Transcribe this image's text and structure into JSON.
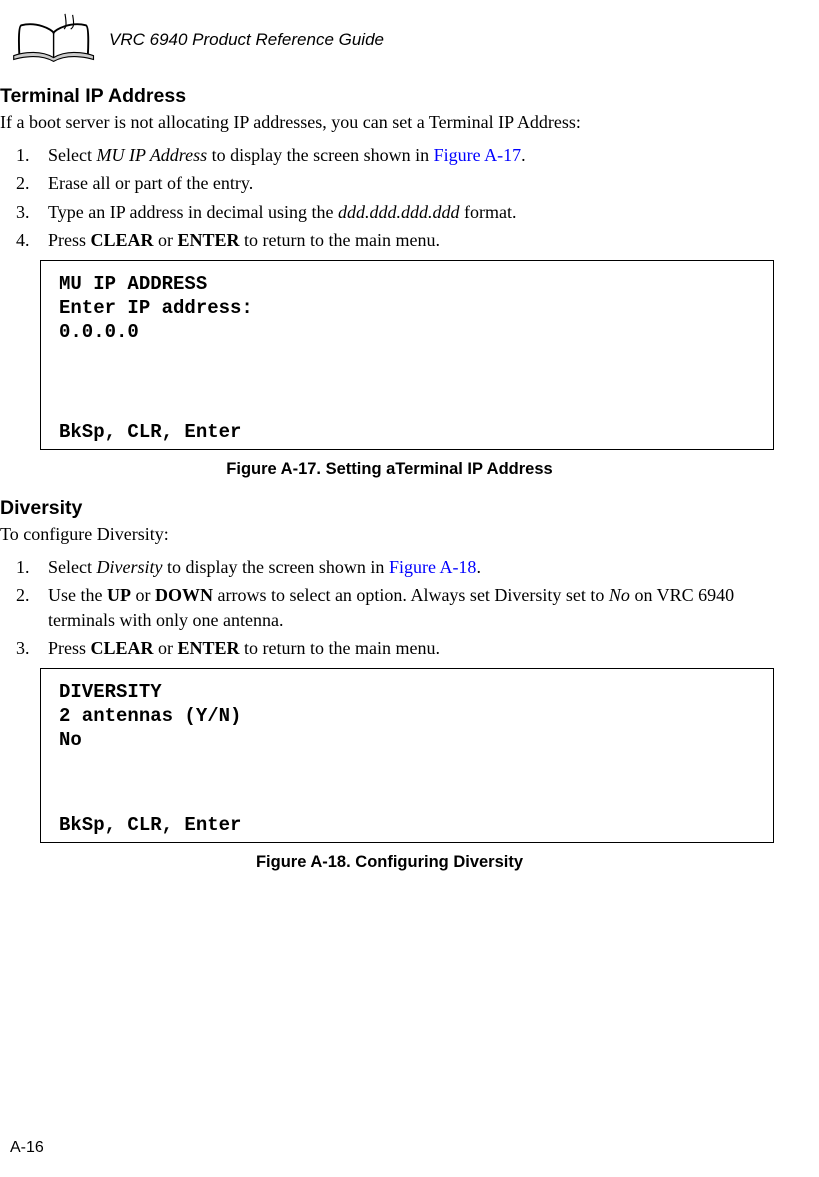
{
  "header": {
    "title": "VRC 6940 Product Reference Guide"
  },
  "section1": {
    "heading": "Terminal IP Address",
    "lead": "If a boot server is not allocating IP addresses, you can set a Terminal IP Address:",
    "steps": {
      "s1_a": "Select ",
      "s1_b": "MU IP Address",
      "s1_c": " to display the screen shown in ",
      "s1_link": "Figure A-17",
      "s1_d": ".",
      "s2": "Erase all or part of the entry.",
      "s3_a": "Type an IP address in decimal using the ",
      "s3_b": "ddd.ddd.ddd.ddd",
      "s3_c": " format.",
      "s4_a": "Press ",
      "s4_b": "CLEAR",
      "s4_c": " or ",
      "s4_d": "ENTER",
      "s4_e": " to return to the main menu."
    },
    "terminal": {
      "line1": "MU IP ADDRESS",
      "line2": "Enter IP address:",
      "line3": "0.0.0.0",
      "footer": "BkSp, CLR, Enter"
    },
    "caption": "Figure A-17.  Setting aTerminal IP Address"
  },
  "section2": {
    "heading": "Diversity",
    "lead": "To configure Diversity:",
    "steps": {
      "s1_a": "Select ",
      "s1_b": "Diversity",
      "s1_c": " to display the screen shown in ",
      "s1_link": "Figure A-18",
      "s1_d": ".",
      "s2_a": "Use the ",
      "s2_b": "UP",
      "s2_c": " or ",
      "s2_d": "DOWN",
      "s2_e": " arrows to select an option. Always set Diversity set to ",
      "s2_f": "No",
      "s2_g": " on VRC 6940 terminals with only one antenna.",
      "s3_a": "Press ",
      "s3_b": "CLEAR",
      "s3_c": " or ",
      "s3_d": "ENTER",
      "s3_e": " to return to the main menu."
    },
    "terminal": {
      "line1": "DIVERSITY",
      "line2": "2 antennas (Y/N)",
      "line3": "No",
      "footer": "BkSp, CLR, Enter"
    },
    "caption": "Figure A-18.  Configuring Diversity"
  },
  "pageNumber": "A-16"
}
